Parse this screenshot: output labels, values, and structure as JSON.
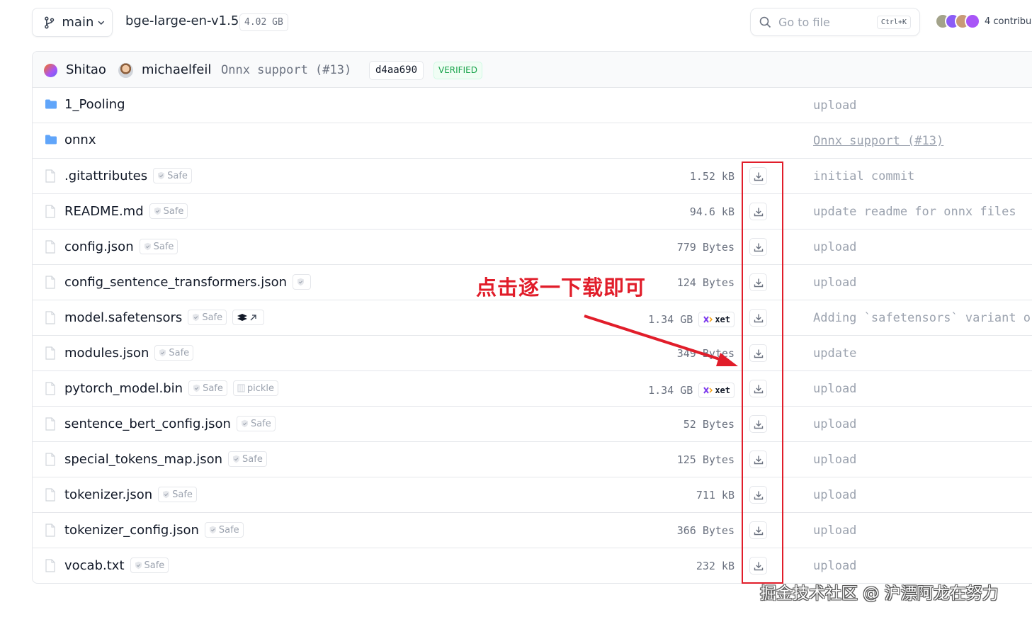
{
  "header": {
    "branch": "main",
    "repo_name": "bge-large-en-v1.5",
    "repo_size": "4.02 GB",
    "search_placeholder": "Go to file",
    "search_shortcut": "Ctrl+K",
    "contributors": "4 contribu"
  },
  "commit": {
    "author1": "Shitao",
    "author2": "michaelfeil",
    "message": "Onnx support (#13)",
    "sha": "d4aa690",
    "verified": "VERIFIED"
  },
  "rows": [
    {
      "name": "1_Pooling",
      "type": "folder",
      "size": "",
      "last_commit": "upload"
    },
    {
      "name": "onnx",
      "type": "folder",
      "size": "",
      "last_commit": "Onnx support (#13)"
    },
    {
      "name": ".gitattributes",
      "type": "file",
      "badge": "Safe",
      "size": "1.52 kB",
      "last_commit": "initial commit"
    },
    {
      "name": "README.md",
      "type": "file",
      "badge": "Safe",
      "size": "94.6 kB",
      "last_commit": "update readme for onnx files"
    },
    {
      "name": "config.json",
      "type": "file",
      "badge": "Safe",
      "size": "779 Bytes",
      "last_commit": "upload"
    },
    {
      "name": "config_sentence_transformers.json",
      "type": "file",
      "badge": "",
      "size": "124 Bytes",
      "last_commit": "upload"
    },
    {
      "name": "model.safetensors",
      "type": "file",
      "badge": "Safe",
      "size": "1.34 GB",
      "storage": "xet",
      "last_commit": "Adding `safetensors` variant o"
    },
    {
      "name": "modules.json",
      "type": "file",
      "badge": "Safe",
      "size": "349 Bytes",
      "last_commit": "update"
    },
    {
      "name": "pytorch_model.bin",
      "type": "file",
      "badge": "Safe",
      "extra_badge": "pickle",
      "size": "1.34 GB",
      "storage": "xet",
      "last_commit": "upload"
    },
    {
      "name": "sentence_bert_config.json",
      "type": "file",
      "badge": "Safe",
      "size": "52 Bytes",
      "last_commit": "upload"
    },
    {
      "name": "special_tokens_map.json",
      "type": "file",
      "badge": "Safe",
      "size": "125 Bytes",
      "last_commit": "upload"
    },
    {
      "name": "tokenizer.json",
      "type": "file",
      "badge": "Safe",
      "size": "711 kB",
      "last_commit": "upload"
    },
    {
      "name": "tokenizer_config.json",
      "type": "file",
      "badge": "Safe",
      "size": "366 Bytes",
      "last_commit": "upload"
    },
    {
      "name": "vocab.txt",
      "type": "file",
      "badge": "Safe",
      "size": "232 kB",
      "last_commit": "upload"
    }
  ],
  "annotation": {
    "text": "点击逐一下载即可",
    "color": "#e11d2a"
  },
  "watermark": "掘金技术社区 @ 沪漂阿龙在努力",
  "colors": {
    "folder": "#60a5fa",
    "verified": "#16a34a"
  }
}
